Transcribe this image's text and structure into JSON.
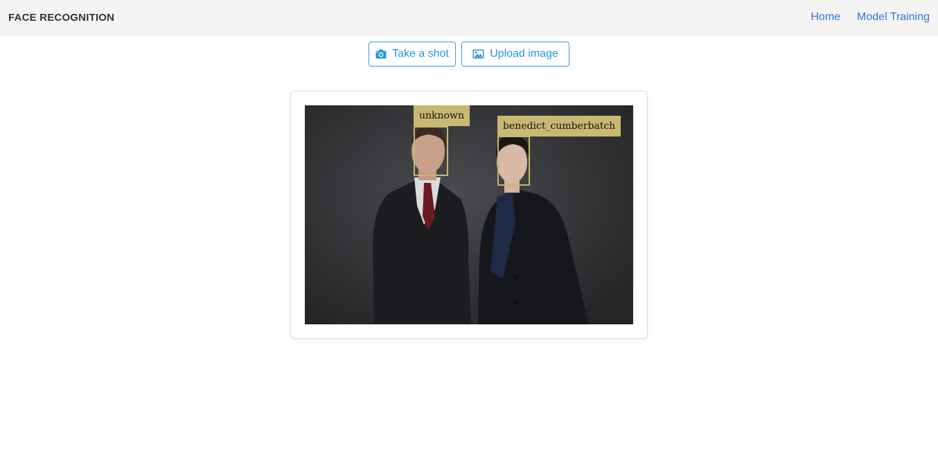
{
  "navbar": {
    "brand": "FACE RECOGNITION",
    "links": [
      {
        "label": "Home"
      },
      {
        "label": "Model Training"
      }
    ]
  },
  "toolbar": {
    "take_shot": {
      "label": "Take a shot",
      "icon": "camera-icon"
    },
    "upload_image": {
      "label": "Upload image",
      "icon": "image-icon"
    }
  },
  "result": {
    "faces": [
      {
        "label": "unknown"
      },
      {
        "label": "benedict_cumberbatch"
      }
    ]
  },
  "colors": {
    "accent": "#3298dc",
    "link": "#3273dc",
    "face_box": "#c8b872",
    "navbar_bg": "#f4f4f4"
  }
}
